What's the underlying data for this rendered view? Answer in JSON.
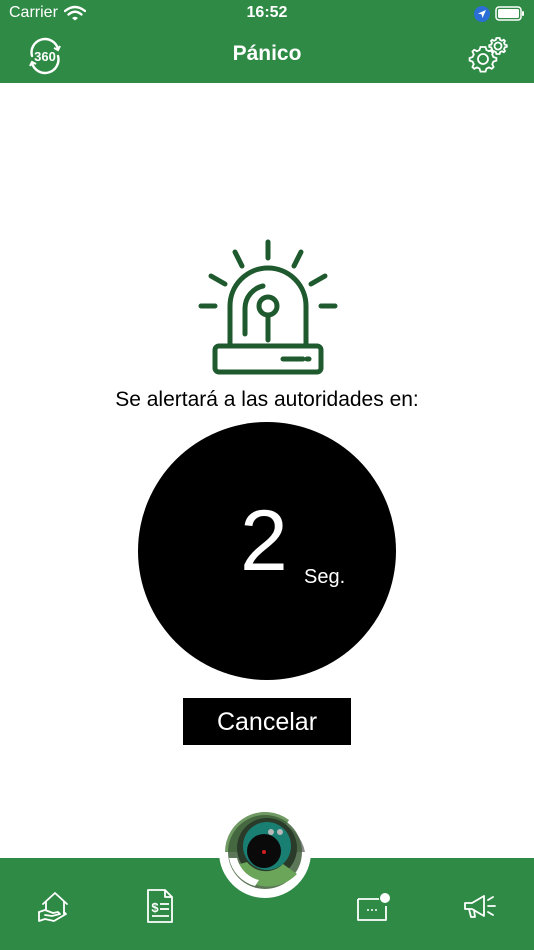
{
  "status_bar": {
    "carrier": "Carrier",
    "time": "16:52",
    "icons": [
      "wifi-icon",
      "location-arrow-icon",
      "battery-icon"
    ]
  },
  "nav_bar": {
    "logo_text": "360",
    "title": "Pánico",
    "settings_icon": "gear-icon"
  },
  "alert": {
    "icon": "siren-icon",
    "message": "Se alertará a las autoridades en:",
    "countdown_value": "2",
    "countdown_unit": "Seg.",
    "cancel_label": "Cancelar"
  },
  "tab_bar": {
    "items": [
      "home-hand-icon",
      "bill-icon",
      "camera-eye-icon",
      "message-icon",
      "megaphone-icon"
    ]
  },
  "colors": {
    "accent_green": "#2f8a45",
    "icon_green": "#1f5a2e",
    "countdown_bg": "#000000",
    "text": "#000000"
  }
}
